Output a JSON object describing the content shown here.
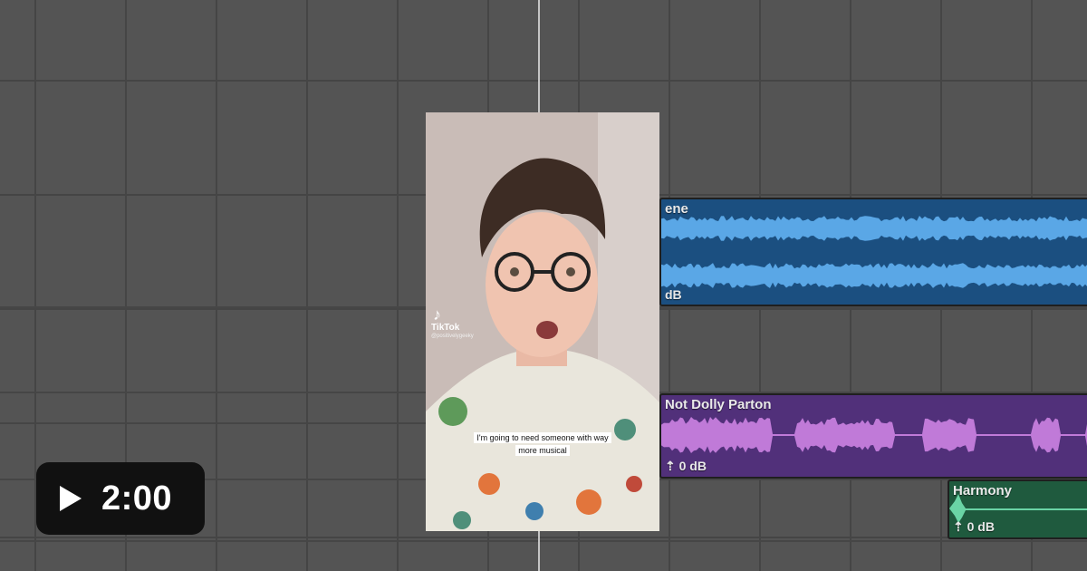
{
  "tracks": [
    {
      "label": "ene",
      "gain": "dB",
      "color": "#4f9ee0"
    },
    {
      "label": "Not Dolly Parton",
      "gain": "0 dB",
      "color": "#c07ad8"
    },
    {
      "label": "Harmony",
      "gain": "0 dB",
      "color": "#6ad4a5"
    }
  ],
  "video": {
    "caption": "I'm going to need someone with way more musical",
    "watermark": "TikTok",
    "handle": "@positivelygeeky",
    "logo_icon": "tiktok-logo-icon"
  },
  "player": {
    "duration": "2:00",
    "play_icon": "play-icon"
  }
}
